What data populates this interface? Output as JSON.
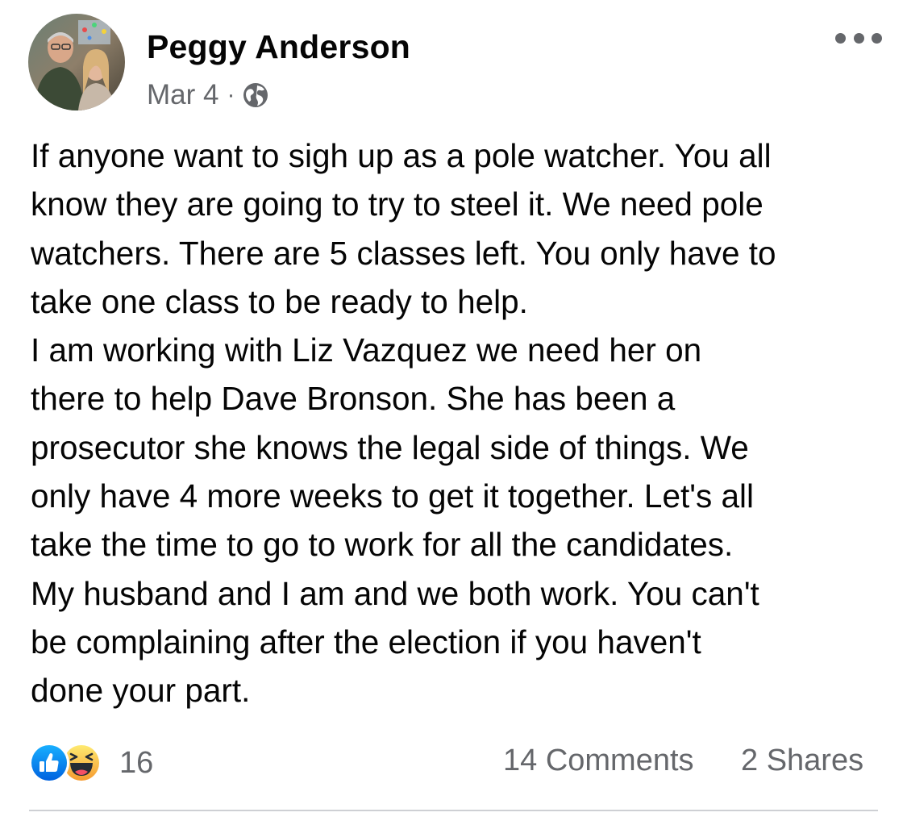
{
  "post": {
    "author": "Peggy Anderson",
    "date": "Mar 4",
    "separator": "·",
    "privacy_icon": "globe-icon",
    "more_icon": "more-options-icon",
    "text_lines": [
      "If anyone want to sigh up as a pole watcher. You all",
      "know they are going to try to steel it. We need pole",
      "watchers. There are 5 classes left. You only have to",
      "take one class to be ready to help.",
      "I am working with Liz Vazquez we need her on",
      "there to help Dave Bronson. She has been a",
      "prosecutor she knows the legal side of things. We",
      "only have 4 more weeks to get it together. Let's all",
      "take the time to go to work for all the candidates.",
      "My husband and I am and we both work. You can't",
      "be complaining after the election if you haven't",
      "done your part."
    ]
  },
  "footer": {
    "reaction_icons": [
      "like-icon",
      "haha-icon"
    ],
    "reaction_count": "16",
    "comments": "14 Comments",
    "shares": "2 Shares"
  },
  "colors": {
    "text": "#050505",
    "secondary_text": "#65676b",
    "like_blue": "#1b74e4",
    "haha_yellow": "#f7b928",
    "divider": "#ced0d4"
  }
}
